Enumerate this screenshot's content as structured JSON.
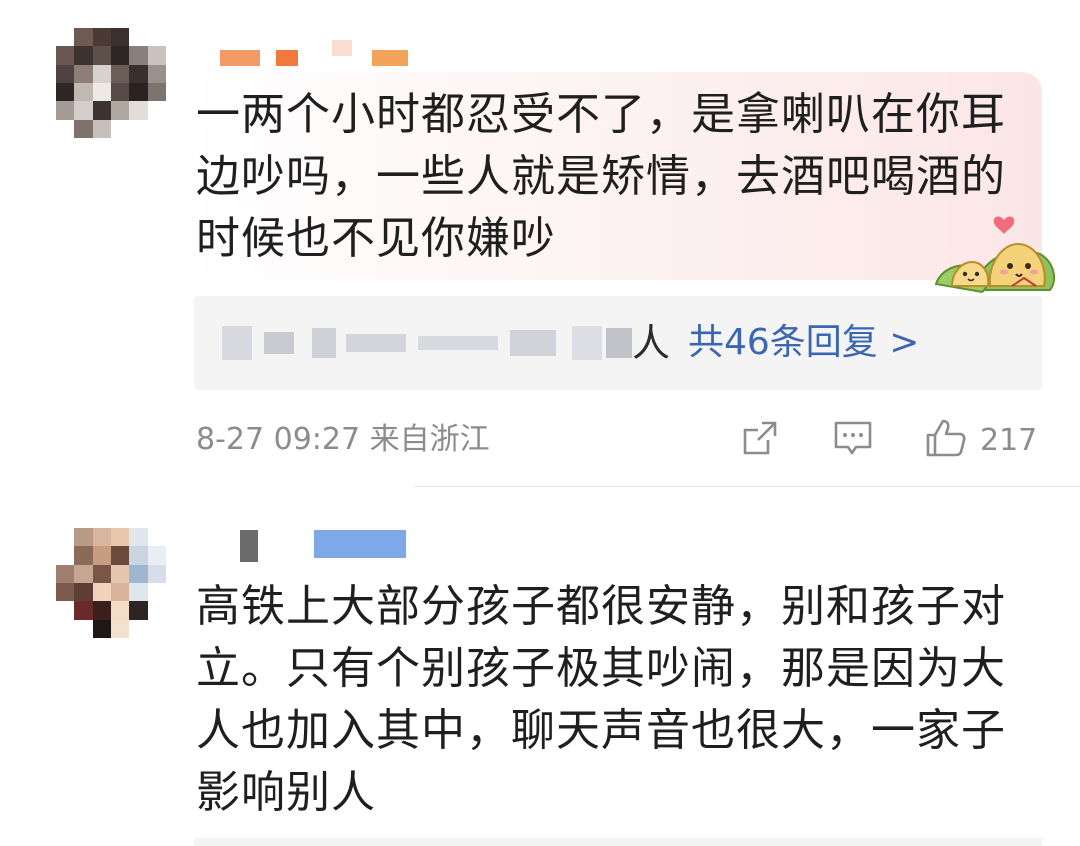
{
  "comments": [
    {
      "text": "一两个小时都忍受不了，是拿喇叭在你耳\n边吵吗，一些人就是矫情，去酒吧喝酒的\n时候也不见你嫌吵",
      "replies": {
        "preview_tail": "人",
        "count_label": "共46条回复 >"
      },
      "meta": {
        "time_location": "8-27 09:27 来自浙江",
        "like_count": "217"
      },
      "icons": {
        "share": "share-icon",
        "comment": "comment-icon",
        "like": "thumbs-up-icon",
        "sticker": "dumpling-sticker-icon"
      }
    },
    {
      "text": "高铁上大部分孩子都很安静，别和孩子对\n立。只有个别孩子极其吵闹，那是因为大\n人也加入其中，聊天声音也很大，一家子\n影响别人"
    }
  ],
  "colors": {
    "link": "#3c66b0",
    "meta_gray": "#8c8c8c",
    "reply_box_bg": "#f4f4f5",
    "bubble_pink": "#fbe6e6"
  }
}
